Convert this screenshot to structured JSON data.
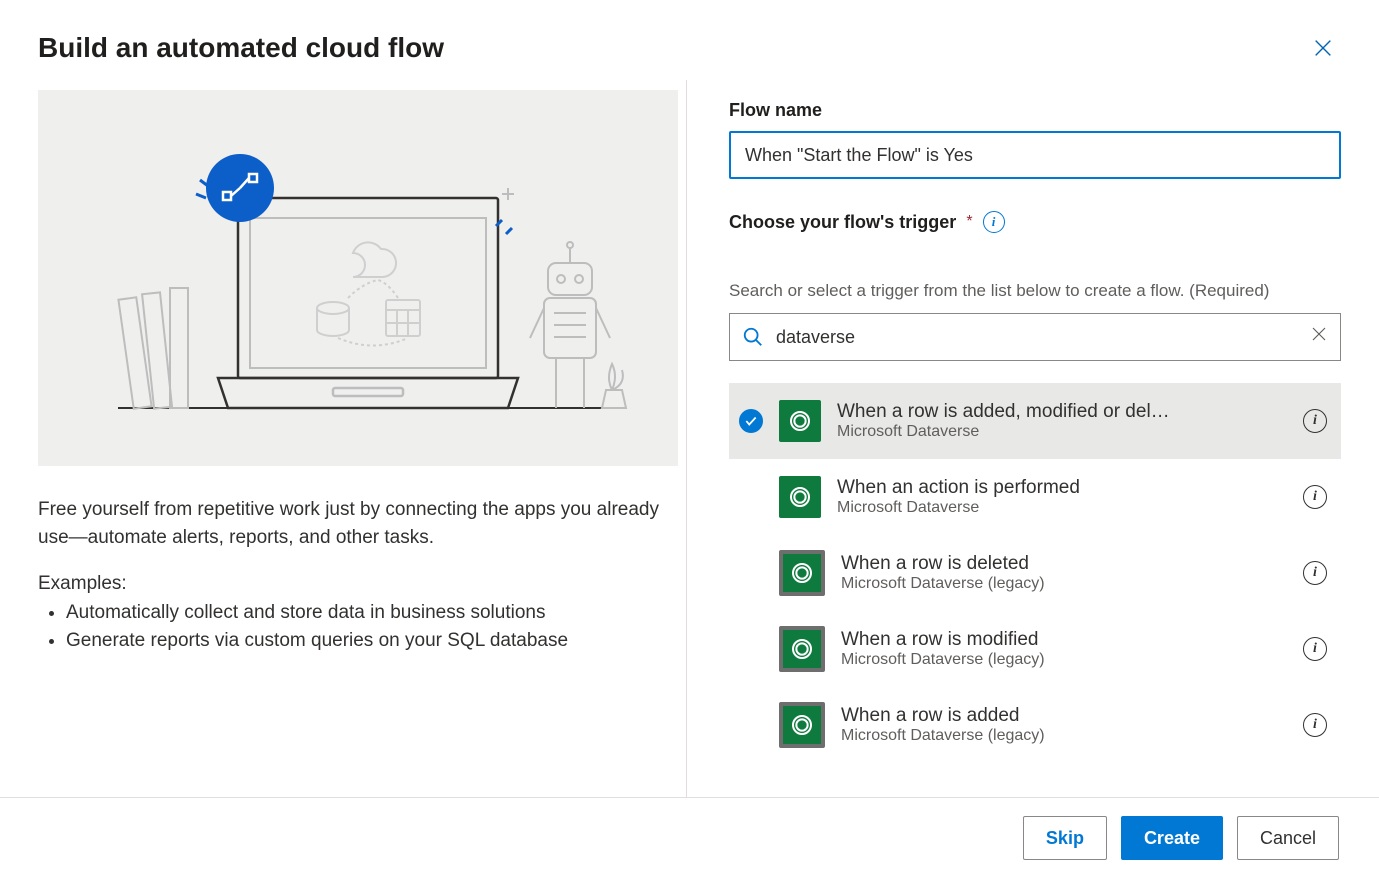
{
  "dialog": {
    "title": "Build an automated cloud flow",
    "description": "Free yourself from repetitive work just by connecting the apps you already use—automate alerts, reports, and other tasks.",
    "examples_label": "Examples:",
    "examples": [
      "Automatically collect and store data in business solutions",
      "Generate reports via custom queries on your SQL database"
    ]
  },
  "form": {
    "flowname_label": "Flow name",
    "flowname_value": "When \"Start the Flow\" is Yes",
    "trigger_label": "Choose your flow's trigger",
    "required_mark": "*",
    "helper_text": "Search or select a trigger from the list below to create a flow. (Required)",
    "search_value": "dataverse"
  },
  "triggers": [
    {
      "title": "When a row is added, modified or del…",
      "subtitle": "Microsoft Dataverse",
      "selected": true,
      "legacy": false
    },
    {
      "title": "When an action is performed",
      "subtitle": "Microsoft Dataverse",
      "selected": false,
      "legacy": false
    },
    {
      "title": "When a row is deleted",
      "subtitle": "Microsoft Dataverse (legacy)",
      "selected": false,
      "legacy": true
    },
    {
      "title": "When a row is modified",
      "subtitle": "Microsoft Dataverse (legacy)",
      "selected": false,
      "legacy": true
    },
    {
      "title": "When a row is added",
      "subtitle": "Microsoft Dataverse (legacy)",
      "selected": false,
      "legacy": true
    }
  ],
  "footer": {
    "skip": "Skip",
    "create": "Create",
    "cancel": "Cancel"
  }
}
